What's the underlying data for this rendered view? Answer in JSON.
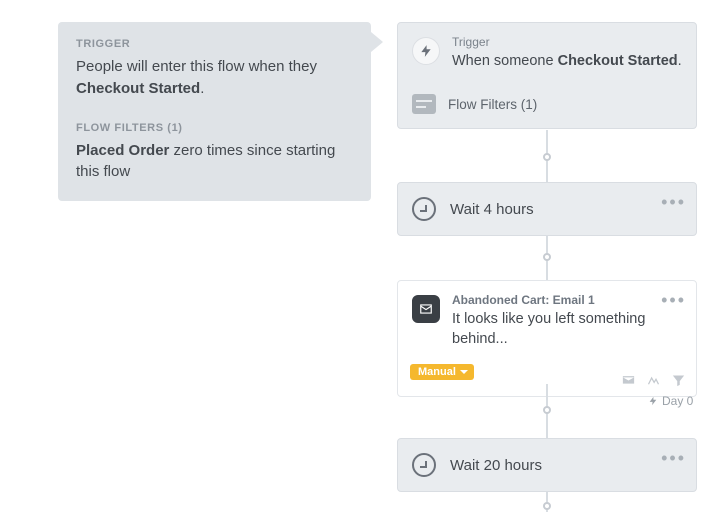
{
  "info": {
    "trigger_label": "TRIGGER",
    "trigger_text_prefix": "People will enter this flow when they ",
    "trigger_text_bold": "Checkout Started",
    "trigger_text_suffix": ".",
    "filters_label": "FLOW FILTERS (1)",
    "filters_text_bold": "Placed Order",
    "filters_text_rest": " zero times since starting this flow"
  },
  "trigger_card": {
    "label": "Trigger",
    "text_prefix": "When someone ",
    "text_bold": "Checkout Started",
    "text_suffix": ".",
    "filters_label": "Flow Filters (1)"
  },
  "wait1": {
    "text": "Wait 4 hours"
  },
  "email": {
    "title": "Abandoned Cart: Email 1",
    "body": "It looks like you left something behind...",
    "badge": "Manual"
  },
  "day": {
    "label": "Day 0"
  },
  "wait2": {
    "text": "Wait 20 hours"
  }
}
